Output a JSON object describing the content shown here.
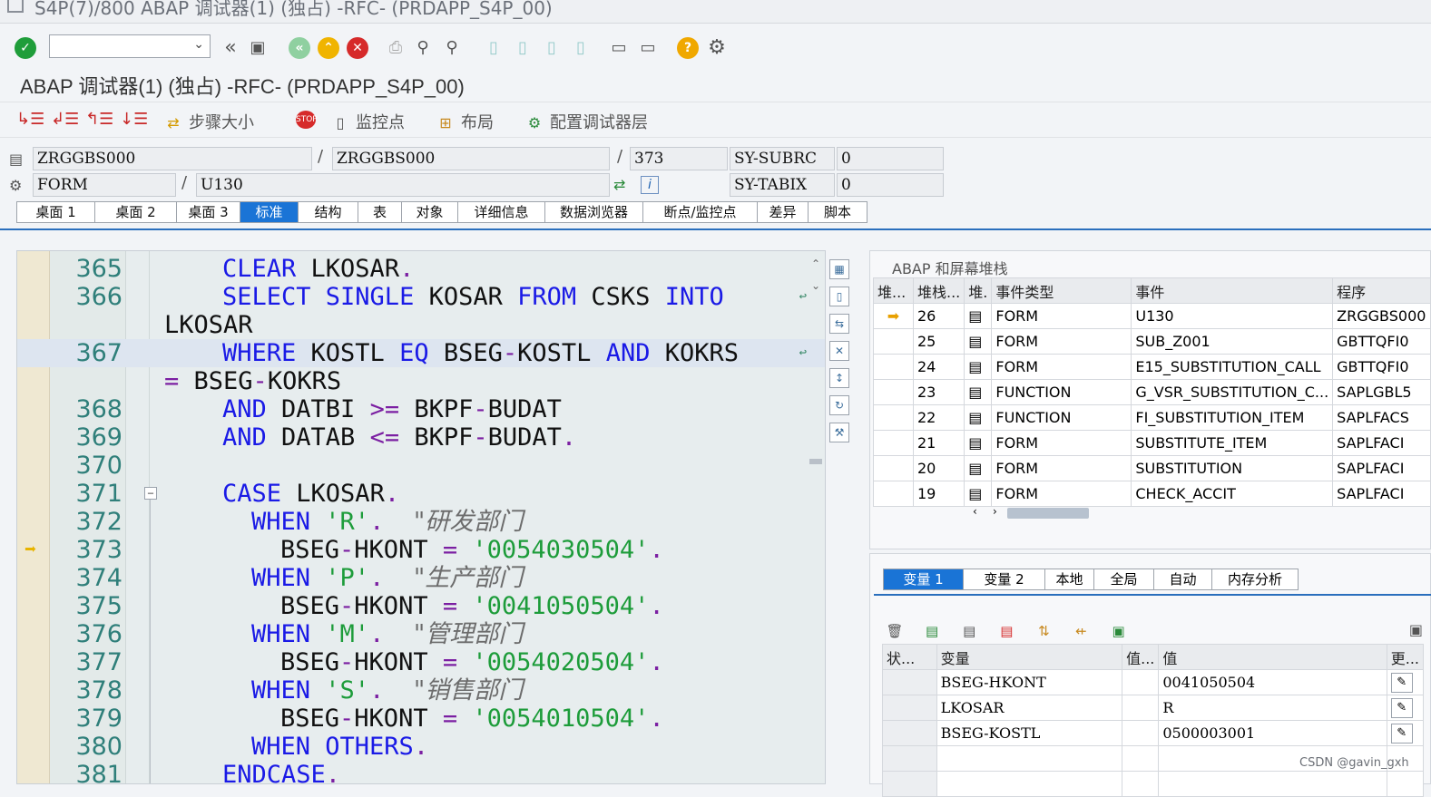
{
  "window": {
    "title": "S4P(7)/800 ABAP 调试器(1) (独占) -RFC- (PRDAPP_S4P_00)"
  },
  "app_title": "ABAP 调试器(1) (独占) -RFC- (PRDAPP_S4P_00)",
  "app_toolbar": {
    "step_size_label": "步骤大小",
    "watchpoint_label": "监控点",
    "layout_label": "布局",
    "config_label": "配置调试器层"
  },
  "fields": {
    "program": "ZRGGBS000",
    "include": "ZRGGBS000",
    "line": "373",
    "sysubrc_label": "SY-SUBRC",
    "sysubrc_value": "0",
    "event_type": "FORM",
    "event": "U130",
    "sytabix_label": "SY-TABIX",
    "sytabix_value": "0",
    "slash": "/"
  },
  "tabs": [
    "桌面 1",
    "桌面 2",
    "桌面 3",
    "标准",
    "结构",
    "表",
    "对象",
    "详细信息",
    "数据浏览器",
    "断点/监控点",
    "差异",
    "脚本"
  ],
  "editor": {
    "lines": [
      {
        "no": "365",
        "tokens": [
          [
            "kw",
            "CLEAR"
          ],
          [
            "t",
            " LKOSAR"
          ],
          [
            "op",
            "."
          ]
        ]
      },
      {
        "no": "366",
        "tokens": [
          [
            "kw",
            "SELECT SINGLE"
          ],
          [
            "t",
            " KOSAR "
          ],
          [
            "kw",
            "FROM"
          ],
          [
            "t",
            " CSKS "
          ],
          [
            "kw",
            "INTO"
          ]
        ]
      },
      {
        "no": "",
        "tokens": [
          [
            "t",
            "LKOSAR"
          ]
        ]
      },
      {
        "no": "367",
        "tokens": [
          [
            "kw",
            "WHERE"
          ],
          [
            "t",
            " KOSTL "
          ],
          [
            "kw",
            "EQ"
          ],
          [
            "t",
            " BSEG"
          ],
          [
            "op",
            "-"
          ],
          [
            "t",
            "KOSTL "
          ],
          [
            "kw",
            "AND"
          ],
          [
            "t",
            " KOKRS"
          ]
        ]
      },
      {
        "no": "",
        "tokens": [
          [
            "op",
            "="
          ],
          [
            "t",
            " BSEG"
          ],
          [
            "op",
            "-"
          ],
          [
            "t",
            "KOKRS"
          ]
        ]
      },
      {
        "no": "368",
        "tokens": [
          [
            "kw",
            "AND"
          ],
          [
            "t",
            " DATBI "
          ],
          [
            "op",
            ">="
          ],
          [
            "t",
            " BKPF"
          ],
          [
            "op",
            "-"
          ],
          [
            "t",
            "BUDAT"
          ]
        ]
      },
      {
        "no": "369",
        "tokens": [
          [
            "kw",
            "AND"
          ],
          [
            "t",
            " DATAB "
          ],
          [
            "op",
            "<="
          ],
          [
            "t",
            " BKPF"
          ],
          [
            "op",
            "-"
          ],
          [
            "t",
            "BUDAT"
          ],
          [
            "op",
            "."
          ]
        ]
      },
      {
        "no": "370",
        "tokens": []
      },
      {
        "no": "371",
        "tokens": [
          [
            "kw",
            "CASE"
          ],
          [
            "t",
            " LKOSAR"
          ],
          [
            "op",
            "."
          ]
        ]
      },
      {
        "no": "372",
        "tokens": [
          [
            "kw",
            "WHEN"
          ],
          [
            "t",
            " "
          ],
          [
            "str",
            "'R'"
          ],
          [
            "op",
            "."
          ],
          [
            "t",
            "  "
          ],
          [
            "cmt",
            "\"研发部门"
          ]
        ]
      },
      {
        "no": "373",
        "tokens": [
          [
            "t",
            "BSEG"
          ],
          [
            "op",
            "-"
          ],
          [
            "t",
            "HKONT "
          ],
          [
            "op",
            "="
          ],
          [
            "t",
            " "
          ],
          [
            "str",
            "'0054030504'"
          ],
          [
            "op",
            "."
          ]
        ]
      },
      {
        "no": "374",
        "tokens": [
          [
            "kw",
            "WHEN"
          ],
          [
            "t",
            " "
          ],
          [
            "str",
            "'P'"
          ],
          [
            "op",
            "."
          ],
          [
            "t",
            "  "
          ],
          [
            "cmt",
            "\"生产部门"
          ]
        ]
      },
      {
        "no": "375",
        "tokens": [
          [
            "t",
            "BSEG"
          ],
          [
            "op",
            "-"
          ],
          [
            "t",
            "HKONT "
          ],
          [
            "op",
            "="
          ],
          [
            "t",
            " "
          ],
          [
            "str",
            "'0041050504'"
          ],
          [
            "op",
            "."
          ]
        ]
      },
      {
        "no": "376",
        "tokens": [
          [
            "kw",
            "WHEN"
          ],
          [
            "t",
            " "
          ],
          [
            "str",
            "'M'"
          ],
          [
            "op",
            "."
          ],
          [
            "t",
            "  "
          ],
          [
            "cmt",
            "\"管理部门"
          ]
        ]
      },
      {
        "no": "377",
        "tokens": [
          [
            "t",
            "BSEG"
          ],
          [
            "op",
            "-"
          ],
          [
            "t",
            "HKONT "
          ],
          [
            "op",
            "="
          ],
          [
            "t",
            " "
          ],
          [
            "str",
            "'0054020504'"
          ],
          [
            "op",
            "."
          ]
        ]
      },
      {
        "no": "378",
        "tokens": [
          [
            "kw",
            "WHEN"
          ],
          [
            "t",
            " "
          ],
          [
            "str",
            "'S'"
          ],
          [
            "op",
            "."
          ],
          [
            "t",
            "  "
          ],
          [
            "cmt",
            "\"销售部门"
          ]
        ]
      },
      {
        "no": "379",
        "tokens": [
          [
            "t",
            "BSEG"
          ],
          [
            "op",
            "-"
          ],
          [
            "t",
            "HKONT "
          ],
          [
            "op",
            "="
          ],
          [
            "t",
            " "
          ],
          [
            "str",
            "'0054010504'"
          ],
          [
            "op",
            "."
          ]
        ]
      },
      {
        "no": "380",
        "tokens": [
          [
            "kw",
            "WHEN OTHERS"
          ],
          [
            "op",
            "."
          ]
        ]
      },
      {
        "no": "381",
        "tokens": [
          [
            "kw",
            "ENDCASE"
          ],
          [
            "op",
            "."
          ]
        ]
      }
    ]
  },
  "stack": {
    "title": "ABAP 和屏幕堆栈",
    "columns": [
      "堆...",
      "堆栈...",
      "堆.",
      "事件类型",
      "事件",
      "程序"
    ],
    "rows": [
      {
        "active": true,
        "level": "26",
        "type": "FORM",
        "event": "U130",
        "program": "ZRGGBS000"
      },
      {
        "active": false,
        "level": "25",
        "type": "FORM",
        "event": "SUB_Z001",
        "program": "GBTTQFI0"
      },
      {
        "active": false,
        "level": "24",
        "type": "FORM",
        "event": "E15_SUBSTITUTION_CALL",
        "program": "GBTTQFI0"
      },
      {
        "active": false,
        "level": "23",
        "type": "FUNCTION",
        "event": "G_VSR_SUBSTITUTION_C...",
        "program": "SAPLGBL5"
      },
      {
        "active": false,
        "level": "22",
        "type": "FUNCTION",
        "event": "FI_SUBSTITUTION_ITEM",
        "program": "SAPLFACS"
      },
      {
        "active": false,
        "level": "21",
        "type": "FORM",
        "event": "SUBSTITUTE_ITEM",
        "program": "SAPLFACI"
      },
      {
        "active": false,
        "level": "20",
        "type": "FORM",
        "event": "SUBSTITUTION",
        "program": "SAPLFACI"
      },
      {
        "active": false,
        "level": "19",
        "type": "FORM",
        "event": "CHECK_ACCIT",
        "program": "SAPLFACI"
      }
    ]
  },
  "var_tabs": [
    "变量 1",
    "变量 2",
    "本地",
    "全局",
    "自动",
    "内存分析"
  ],
  "vars": {
    "columns": [
      "状...",
      "变量",
      "值...",
      "值",
      "更..."
    ],
    "rows": [
      {
        "name": "BSEG-HKONT",
        "value": "0041050504"
      },
      {
        "name": "LKOSAR",
        "value": "R"
      },
      {
        "name": "BSEG-KOSTL",
        "value": "0500003001"
      }
    ]
  },
  "watermark": "CSDN @gavin_gxh",
  "colors": {
    "accent": "#1a74d6",
    "keyword": "#1a1ae6",
    "string": "#1d9c3a",
    "linenumber": "#2f7f7a"
  }
}
